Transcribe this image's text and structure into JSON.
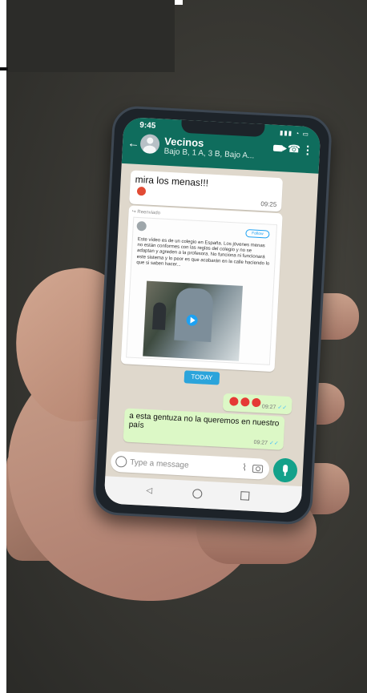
{
  "status_bar": {
    "time": "9:45"
  },
  "header": {
    "title": "Vecinos",
    "subtitle": "Bajo B, 1 A, 3 B, Bajo A..."
  },
  "messages": [
    {
      "id": "msg1",
      "text": "mira los menas!!!",
      "time": "09:25"
    },
    {
      "id": "forward",
      "label": "Reenviado",
      "post_text": "Este vídeo es de un colegio en España. Los jóvenes menas no están conformes con las reglas del colegio y no se adaptan y agreden a la profesora. No funciona ni funcionará este sistema y lo peor es que acabarán en la calle haciendo lo que si saben hacer...",
      "follow_label": "Follow"
    },
    {
      "id": "sent1",
      "time": "09:27"
    },
    {
      "id": "sent2",
      "text": "a esta gentuza no la queremos en nuestro país",
      "time": "09:27"
    }
  ],
  "date_divider": "TODAY",
  "composer": {
    "placeholder": "Type a message"
  },
  "icons": {
    "back": "arrow-left-icon",
    "video": "video-camera-icon",
    "call": "phone-icon",
    "menu": "vertical-dots-icon",
    "emoji": "emoji-icon",
    "attach": "paperclip-icon",
    "camera": "camera-icon",
    "mic": "microphone-icon"
  },
  "colors": {
    "header": "#0f6d5d",
    "incoming_bubble": "#ffffff",
    "outgoing_bubble": "#dcf8c6",
    "today_badge": "#2ba4db",
    "mic_button": "#13a18a"
  }
}
